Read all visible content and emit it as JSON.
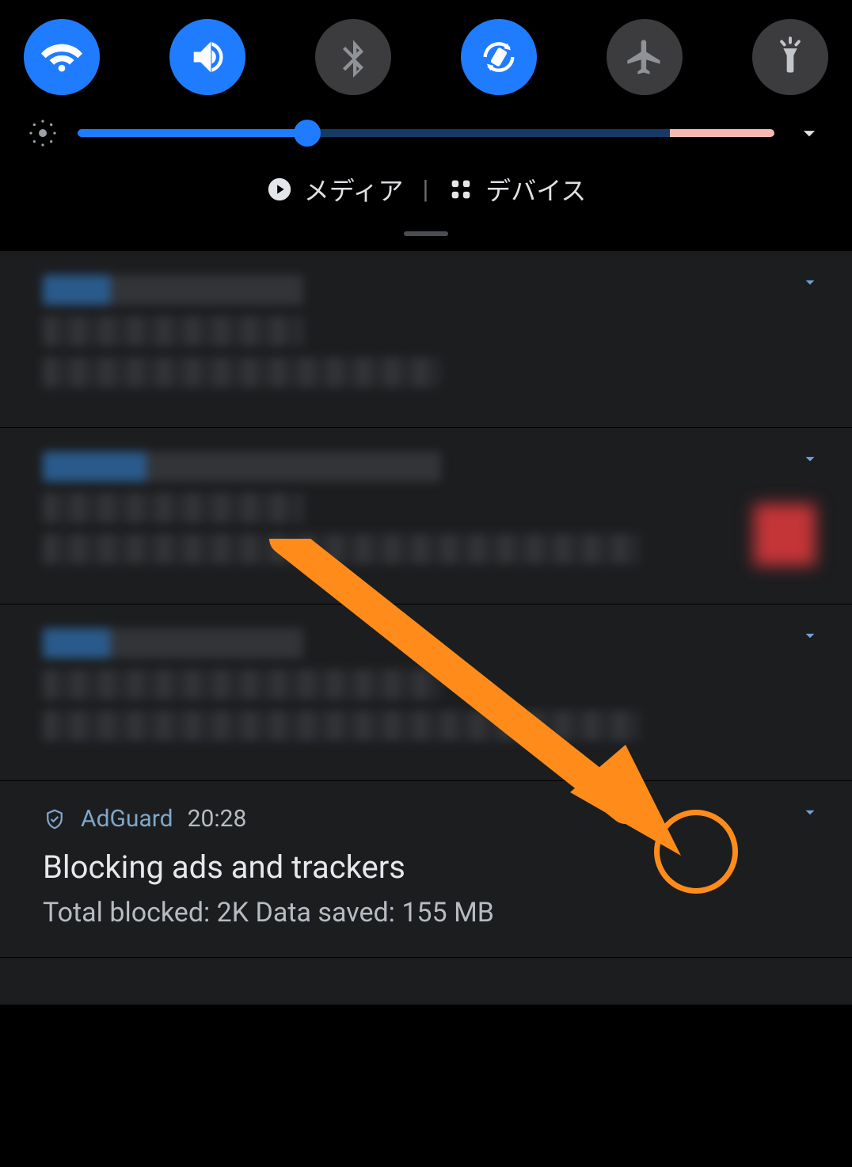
{
  "quick_settings": {
    "wifi": {
      "active": true
    },
    "sound": {
      "active": true
    },
    "bluetooth": {
      "active": false
    },
    "rotate": {
      "active": true
    },
    "airplane": {
      "active": false
    },
    "flashlight": {
      "active": false
    }
  },
  "brightness": {
    "percent": 33
  },
  "media": {
    "label": "メディア"
  },
  "devices": {
    "label": "デバイス"
  },
  "notifications": {
    "adguard": {
      "app_name": "AdGuard",
      "time": "20:28",
      "title": "Blocking ads and trackers",
      "subtitle": "Total blocked: 2K Data saved: 155 MB"
    }
  },
  "colors": {
    "accent": "#1f7cff",
    "annotation": "#ff8c1a"
  }
}
